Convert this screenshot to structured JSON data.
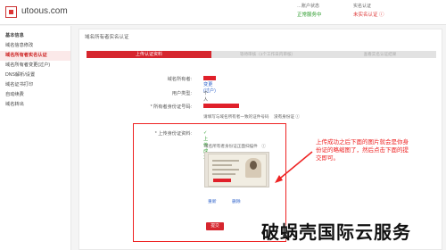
{
  "header": {
    "logo_text": "utoous.com",
    "status_col1_label": "…账户状态",
    "status_col1_value": "正常服务中",
    "status_col2_label": "实名认证",
    "status_col2_value": "未实名认证 ⓘ",
    "colors": {
      "brand": "#d6262e",
      "status_ok": "#2a9a2a",
      "status_warn": "#dd3333"
    }
  },
  "sidebar": {
    "items": [
      {
        "label": "基本信息",
        "kind": "title"
      },
      {
        "label": "域名信息修改",
        "kind": "normal"
      },
      {
        "label": "域名所有者实名认证",
        "kind": "active"
      },
      {
        "label": "域名所有者变更(过户)",
        "kind": "normal"
      },
      {
        "label": "DNS解析/设置",
        "kind": "normal"
      },
      {
        "label": "域名证书打印",
        "kind": "normal"
      },
      {
        "label": "自动续费",
        "kind": "normal"
      },
      {
        "label": "域名转出",
        "kind": "normal"
      }
    ]
  },
  "main": {
    "breadcrumb": "域名所有者实名认证",
    "steps": {
      "active": "上传认证资料",
      "step2": "等待审核（1个工作日内审核）",
      "step3": "查看实名认证结果"
    },
    "form": {
      "owner_label": "域名所有者:",
      "owner_link": "变更(过户)",
      "user_type_label": "用户类型:",
      "user_type_value": "个人",
      "id_number_label": "* 所有者身份证号码:",
      "id_hint": "请填写与域名所有者一致的证件号码",
      "id_hint_link": "没有身份证 ⓘ",
      "upload_label": "* 上传身份证资料:",
      "upload_status": "✓ 上传成功",
      "upload_caption": "域名所有者身份证正面扫描件",
      "reupload_link": "重新",
      "delete_link": "删除",
      "submit_label": "提交"
    }
  },
  "annotation": {
    "text": "上传成功之后下面的图片就会是你身份证的略缩图了，然后点击下面的提交即可。"
  },
  "watermark": "破蜗壳国际云服务"
}
